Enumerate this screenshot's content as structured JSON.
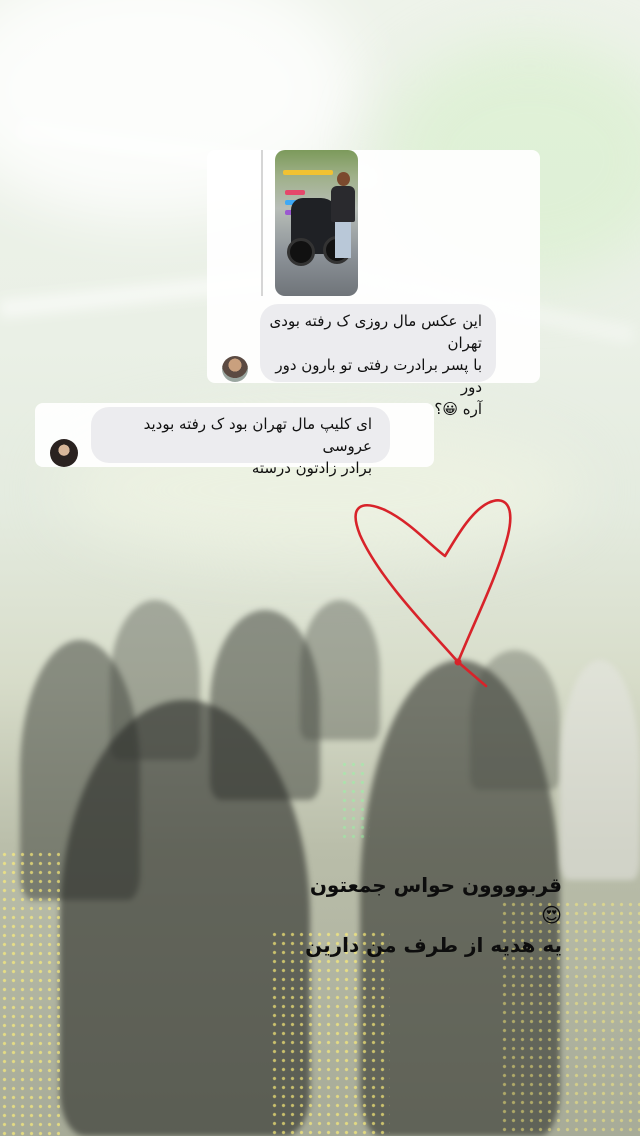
{
  "story": {
    "reply": {
      "message": {
        "line1": "این عکس مال روزی ک رفته بودی تهران",
        "line2": "با پسر برادرت رفتی تو بارون دور دور",
        "line3": "آره 😀؟"
      }
    },
    "second_message": {
      "line1": "ای کلیپ مال تهران بود ک رفته بودید عروسی",
      "line2": "برادر زادتون درسته"
    },
    "caption": {
      "line1": "قربوووون حواس جمعتون😍",
      "line2": "یه هدیه از طرف من دارین"
    },
    "heart_color": "#d8232a"
  }
}
